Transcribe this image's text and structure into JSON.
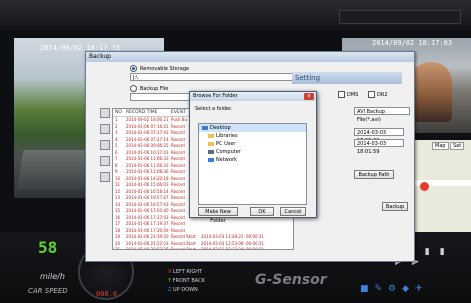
{
  "left_cam": {
    "timestamp": "2014/09/02 18:1? ?3"
  },
  "right_cam": {
    "timestamp": "2014/09/02 18:17:03"
  },
  "dashboard": {
    "speed_value": "58",
    "unit": "mile/h",
    "label": "CAR SPEED",
    "red_value": "000.0",
    "gsensor_label": "G-Sensor",
    "directions": [
      "LEFT",
      "RIGHT",
      "FRONT",
      "BACK",
      "UP",
      "DOWN"
    ]
  },
  "backup_window": {
    "title": "Backup",
    "removable_storage_label": "Removable Storage",
    "drive_value": "J:\\",
    "backup_file_label": "Backup File",
    "setting_label": "Setting",
    "dms_label": "DMS",
    "ddr2_label": "DR2",
    "backup_type_value": "AVI Backup File(*.avi)",
    "start_time_value": "2014-03-03 17:55:29",
    "end_time_value": "2014-03-03 18:01:59",
    "backup_path_label": "Backup Path",
    "backup_button": "Backup",
    "table_headers": {
      "no": "NO",
      "record_time": "RECORD TIME",
      "event": "EVENT"
    },
    "rows": [
      {
        "no": "1",
        "time": "2014-09-02 18:06:21",
        "event": "Push Bu"
      },
      {
        "no": "2",
        "time": "2014-01-06 07:16:41",
        "event": "Record"
      },
      {
        "no": "3",
        "time": "2014-01-06 07:17:41",
        "event": "Record"
      },
      {
        "no": "4",
        "time": "2014-01-06 07:27:14",
        "event": "Record"
      },
      {
        "no": "5",
        "time": "2014-01-06 09:06:25",
        "event": "Record"
      },
      {
        "no": "6",
        "time": "2014-01-06 10:17:41",
        "event": "Record"
      },
      {
        "no": "7",
        "time": "2014-01-06 11:06:33",
        "event": "Record"
      },
      {
        "no": "8",
        "time": "2014-01-06 11:06:33",
        "event": "Record"
      },
      {
        "no": "9",
        "time": "2014-01-06 11:08:36",
        "event": "Record"
      },
      {
        "no": "10",
        "time": "2014-01-06 14:20:18",
        "event": "Record"
      },
      {
        "no": "11",
        "time": "2014-01-06 15:06:03",
        "event": "Record"
      },
      {
        "no": "12",
        "time": "2014-01-06 16:58:14",
        "event": "Record"
      },
      {
        "no": "13",
        "time": "2014-01-06 16:57:47",
        "event": "Record"
      },
      {
        "no": "14",
        "time": "2014-01-06 16:57:43",
        "event": "Record"
      },
      {
        "no": "15",
        "time": "2014-01-06 17:03:40",
        "event": "Record"
      },
      {
        "no": "16",
        "time": "2014-01-06 17:17:03",
        "event": "Record"
      },
      {
        "no": "17",
        "time": "2014-01-06 17:19:37",
        "event": "Record"
      },
      {
        "no": "18",
        "time": "2014-01-06 17:30:09",
        "event": "Record"
      },
      {
        "no": "19",
        "time": "2014-01-06 21:39:50",
        "event": "Record Start",
        "start": "2014-03-03 11:48:21",
        "dur": "00:00:31"
      },
      {
        "no": "20",
        "time": "2014-01-06 21:52:03",
        "event": "Record Start",
        "start": "2014-03-03 12:53:08",
        "dur": "00:00:31"
      },
      {
        "no": "21",
        "time": "2014-01-06 21:57:27",
        "event": "Record Start",
        "start": "2014-03-03 15:12:34",
        "dur": "00:00:31"
      },
      {
        "no": "22",
        "time": "2014-01-06 22:09:04",
        "event": "Record Start",
        "start": "2014-03-03 15:13:10",
        "dur": "00:00:31"
      }
    ]
  },
  "browse_dialog": {
    "title": "Browse For Folder",
    "close_label": "x",
    "prompt": "Select a folder.",
    "tree": [
      "Desktop",
      "Libraries",
      "PC User",
      "Computer",
      "Network"
    ],
    "make_new_folder": "Make New Folder",
    "ok": "OK",
    "cancel": "Cancel"
  },
  "map": {
    "labels": [
      "Map",
      "Sat"
    ]
  }
}
